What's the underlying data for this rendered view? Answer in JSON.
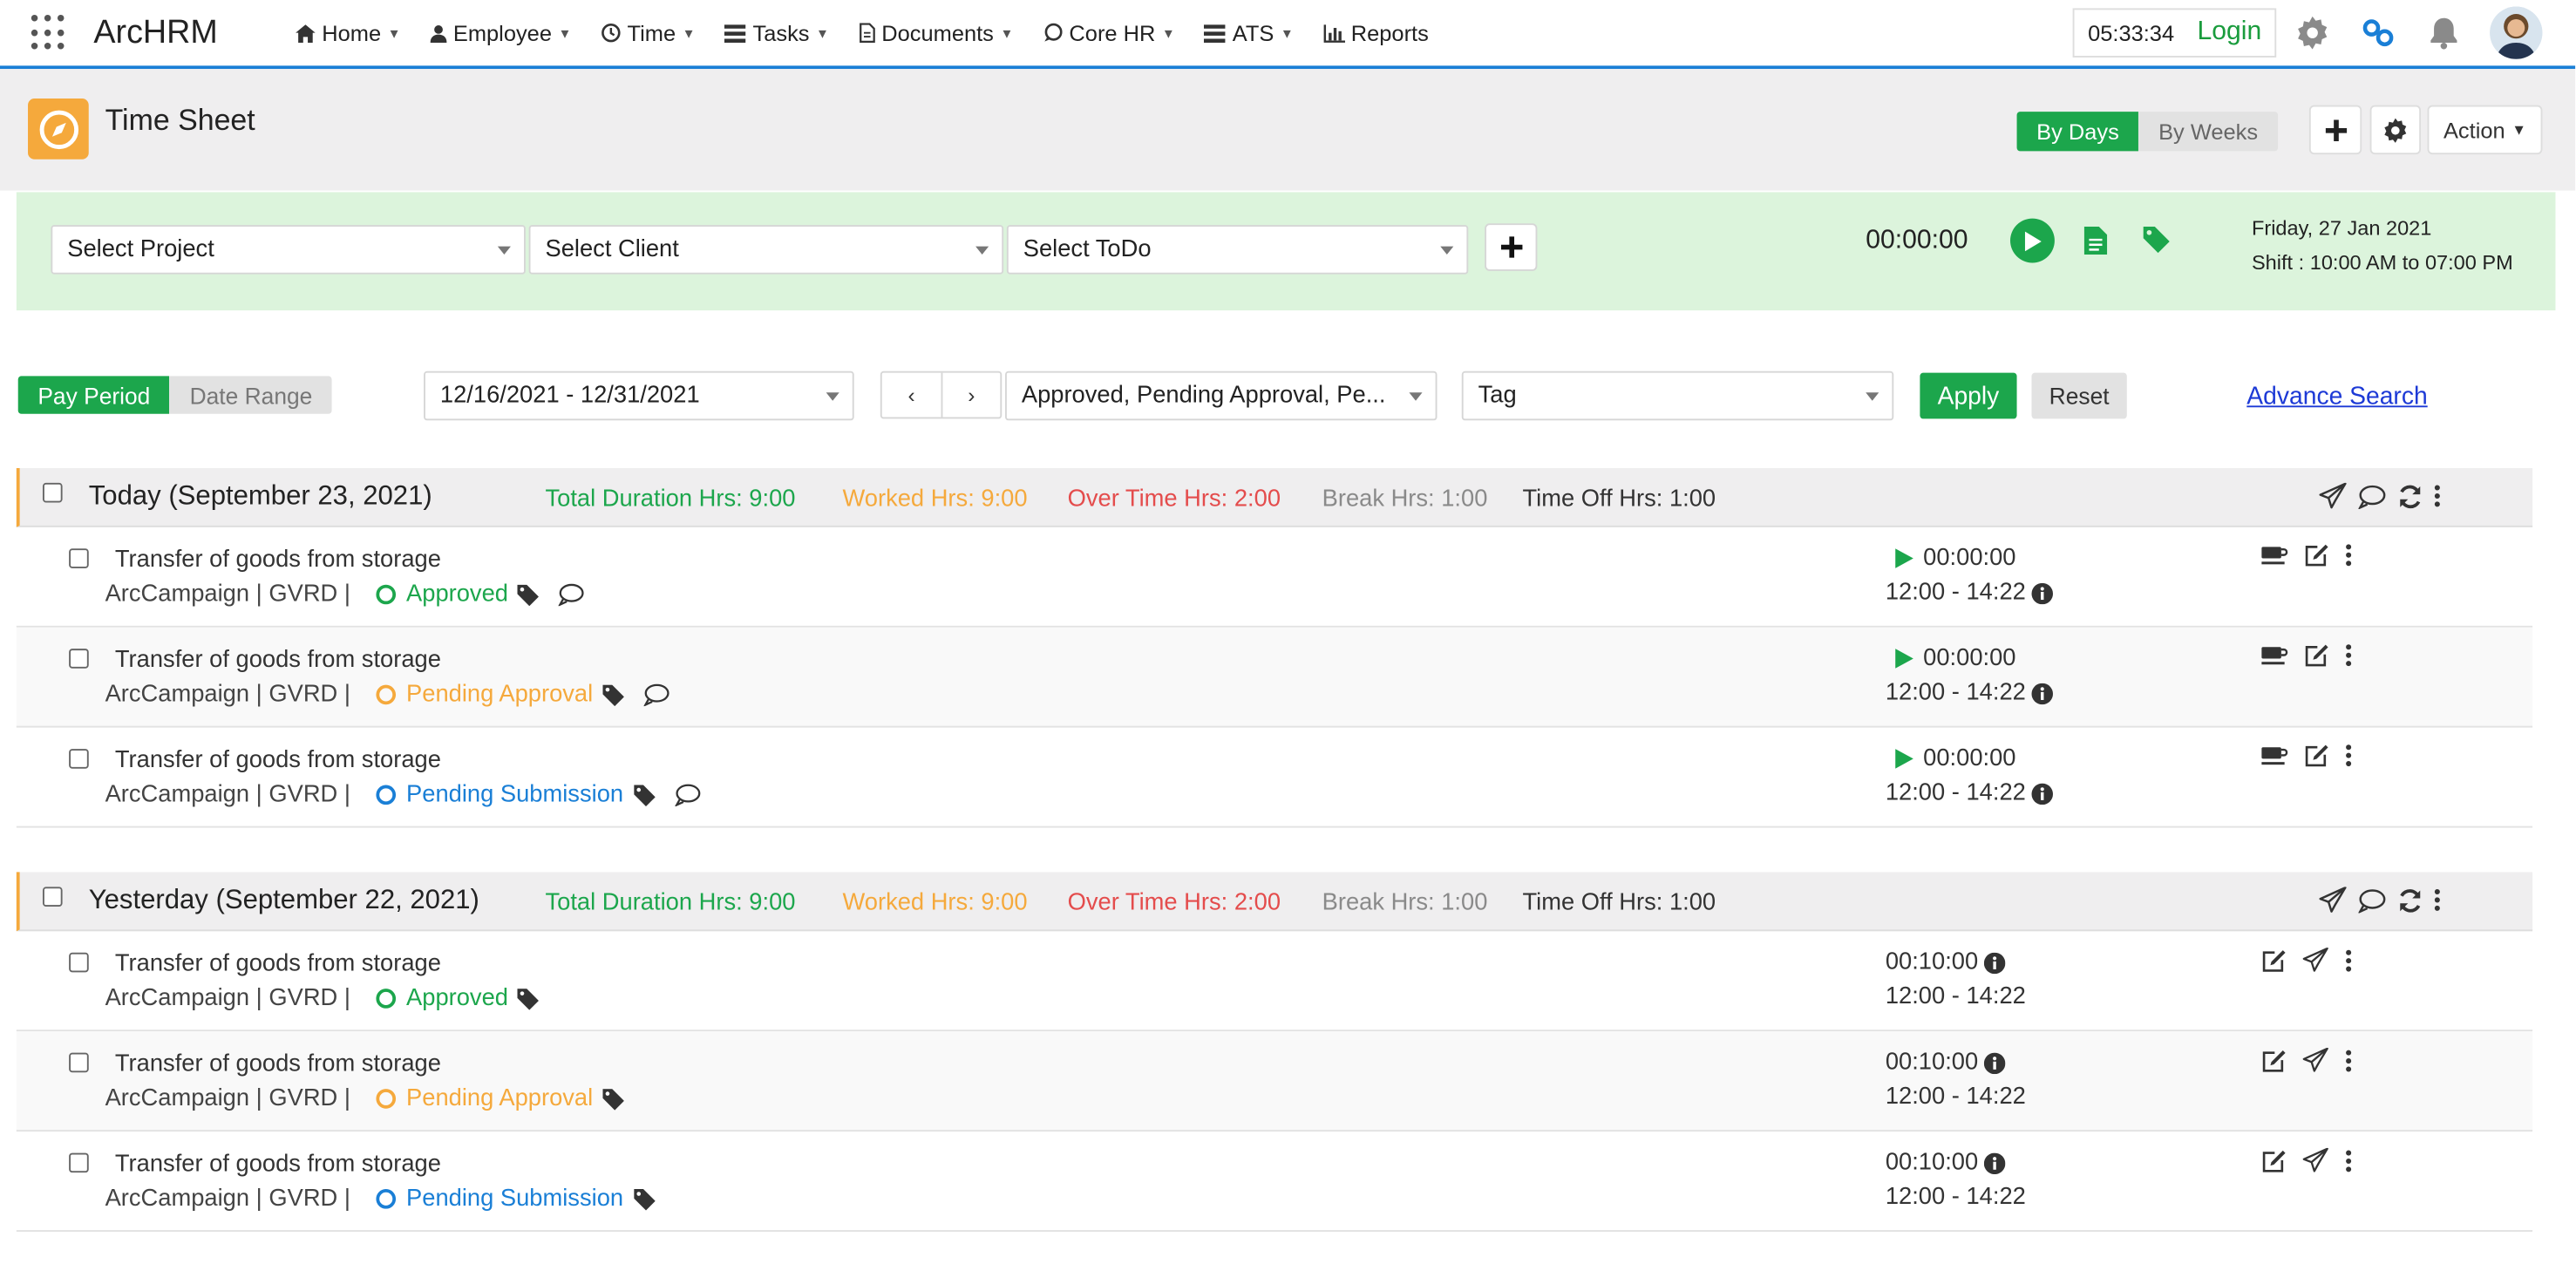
{
  "app": {
    "brand": "ArcHRM",
    "nav": [
      {
        "label": "Home",
        "icon": "home-icon"
      },
      {
        "label": "Employee",
        "icon": "user-icon"
      },
      {
        "label": "Time",
        "icon": "clock-icon"
      },
      {
        "label": "Tasks",
        "icon": "tasks-icon"
      },
      {
        "label": "Documents",
        "icon": "document-icon"
      },
      {
        "label": "Core HR",
        "icon": "chat-icon"
      },
      {
        "label": "ATS",
        "icon": "ats-icon"
      },
      {
        "label": "Reports",
        "icon": "bar-chart-icon"
      }
    ],
    "clock": "05:33:34",
    "login": "Login"
  },
  "page": {
    "title": "Time Sheet",
    "view_toggle": [
      "By Days",
      "By Weeks"
    ],
    "action_label": "Action"
  },
  "tracker": {
    "project_placeholder": "Select Project",
    "client_placeholder": "Select Client",
    "todo_placeholder": "Select ToDo",
    "timer": "00:00:00",
    "date": "Friday, 27 Jan 2021",
    "shift": "Shift : 10:00 AM to 07:00 PM"
  },
  "filters": {
    "period_toggle": [
      "Pay Period",
      "Date Range"
    ],
    "date_range": "12/16/2021 - 12/31/2021",
    "status": "Approved, Pending Approval, Pe...",
    "tag": "Tag",
    "apply": "Apply",
    "reset": "Reset",
    "advance_search": "Advance Search"
  },
  "days": [
    {
      "title": "Today (September 23, 2021)",
      "total": "Total Duration Hrs: 9:00",
      "worked": "Worked Hrs: 9:00",
      "overtime": "Over Time Hrs: 2:00",
      "break": "Break Hrs: 1:00",
      "timeoff": "Time Off Hrs: 1:00",
      "entries": [
        {
          "task": "Transfer of goods from storage",
          "meta": "ArcCampaign | GVRD |",
          "status": "Approved",
          "time": "00:00:00",
          "range": "12:00 - 14:22"
        },
        {
          "task": "Transfer of goods from storage",
          "meta": "ArcCampaign | GVRD |",
          "status": "Pending Approval",
          "time": "00:00:00",
          "range": "12:00 - 14:22"
        },
        {
          "task": "Transfer of goods from storage",
          "meta": "ArcCampaign | GVRD |",
          "status": "Pending Submission",
          "time": "00:00:00",
          "range": "12:00 - 14:22"
        }
      ]
    },
    {
      "title": "Yesterday (September 22, 2021)",
      "total": "Total Duration Hrs: 9:00",
      "worked": "Worked Hrs: 9:00",
      "overtime": "Over Time Hrs: 2:00",
      "break": "Break Hrs: 1:00",
      "timeoff": "Time Off Hrs: 1:00",
      "entries": [
        {
          "task": "Transfer of goods from storage",
          "meta": "ArcCampaign | GVRD |",
          "status": "Approved",
          "time": "00:10:00",
          "range": "12:00 - 14:22"
        },
        {
          "task": "Transfer of goods from storage",
          "meta": "ArcCampaign | GVRD |",
          "status": "Pending Approval",
          "time": "00:10:00",
          "range": "12:00 - 14:22"
        },
        {
          "task": "Transfer of goods from storage",
          "meta": "ArcCampaign | GVRD |",
          "status": "Pending Submission",
          "time": "00:10:00",
          "range": "12:00 - 14:22"
        }
      ]
    }
  ],
  "colors": {
    "accent_green": "#1ca64c",
    "approved": "#1ca64c",
    "pending_approval": "#f5a93c",
    "pending_submission": "#1a7fd6",
    "overtime": "#e44c4c",
    "nav_border": "#1a7fd6",
    "tracker_bg": "#dcf4dc"
  }
}
